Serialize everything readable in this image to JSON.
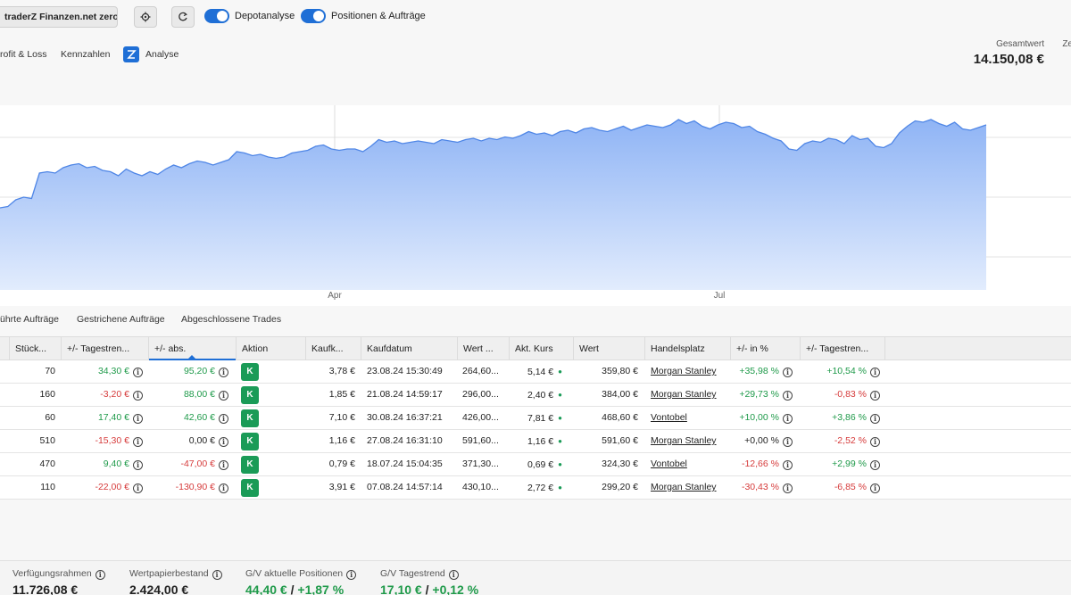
{
  "toolbar": {
    "account_label": "traderZ Finanzen.net zero",
    "toggle1_label": "Depotanalyse",
    "toggle2_label": "Positionen & Aufträge"
  },
  "subnav": {
    "items": [
      "rofit & Loss",
      "Kennzahlen",
      "Analyse"
    ]
  },
  "total": {
    "label": "Gesamtwert",
    "value": "14.150,08 €",
    "next_label": "Ze"
  },
  "chart_data": {
    "type": "area",
    "title": "",
    "xlabel": "",
    "ylabel": "",
    "x_tick_labels": [
      "Apr",
      "Jul"
    ],
    "grid": true,
    "color": "#8fb4f5",
    "line_color": "#4f86e6",
    "series": [
      {
        "values": [
          0.36,
          0.37,
          0.42,
          0.44,
          0.43,
          0.62,
          0.63,
          0.62,
          0.66,
          0.68,
          0.69,
          0.66,
          0.67,
          0.64,
          0.63,
          0.6,
          0.65,
          0.62,
          0.6,
          0.63,
          0.61,
          0.65,
          0.68,
          0.66,
          0.69,
          0.71,
          0.7,
          0.68,
          0.7,
          0.72,
          0.78,
          0.77,
          0.75,
          0.76,
          0.74,
          0.73,
          0.74,
          0.77,
          0.78,
          0.79,
          0.82,
          0.83,
          0.8,
          0.79,
          0.8,
          0.8,
          0.78,
          0.82,
          0.87,
          0.85,
          0.86,
          0.84,
          0.85,
          0.86,
          0.85,
          0.84,
          0.87,
          0.86,
          0.85,
          0.87,
          0.88,
          0.86,
          0.88,
          0.87,
          0.89,
          0.88,
          0.9,
          0.93,
          0.91,
          0.92,
          0.9,
          0.93,
          0.94,
          0.92,
          0.95,
          0.96,
          0.94,
          0.93,
          0.95,
          0.97,
          0.94,
          0.96,
          0.98,
          0.97,
          0.96,
          0.98,
          1.02,
          0.99,
          1.01,
          0.97,
          0.95,
          0.98,
          1.0,
          0.99,
          0.96,
          0.97,
          0.93,
          0.91,
          0.88,
          0.86,
          0.8,
          0.79,
          0.84,
          0.86,
          0.85,
          0.88,
          0.87,
          0.84,
          0.9,
          0.87,
          0.88,
          0.82,
          0.81,
          0.84,
          0.92,
          0.97,
          1.01,
          1.0,
          1.02,
          0.99,
          0.97,
          1.0,
          0.95,
          0.94,
          0.96,
          0.98
        ]
      }
    ]
  },
  "tabs": [
    "ührte Aufträge",
    "Gestrichene Aufträge",
    "Abgeschlossene Trades"
  ],
  "table": {
    "headers": [
      "Stück...",
      "+/- Tagestren...",
      "+/- abs.",
      "Aktion",
      "Kaufk...",
      "Kaufdatum",
      "Wert ...",
      "Akt. Kurs",
      "Wert",
      "Handelsplatz",
      "+/- in %",
      "+/- Tagestren..."
    ],
    "rows": [
      {
        "qty": "70",
        "day": "34,30 €",
        "day_sign": "pos",
        "abs": "95,20 €",
        "abs_sign": "pos",
        "action": "K",
        "buy": "3,78 €",
        "date": "23.08.24 15:30:49",
        "buyval": "264,60...",
        "price": "5,14 €",
        "value": "359,80 €",
        "venue": "Morgan Stanley",
        "pct": "+35,98 %",
        "pct_sign": "pos",
        "trend": "+10,54 %",
        "trend_sign": "pos"
      },
      {
        "qty": "160",
        "day": "-3,20 €",
        "day_sign": "neg",
        "abs": "88,00 €",
        "abs_sign": "pos",
        "action": "K",
        "buy": "1,85 €",
        "date": "21.08.24 14:59:17",
        "buyval": "296,00...",
        "price": "2,40 €",
        "value": "384,00 €",
        "venue": "Morgan Stanley",
        "pct": "+29,73 %",
        "pct_sign": "pos",
        "trend": "-0,83 %",
        "trend_sign": "neg"
      },
      {
        "qty": "60",
        "day": "17,40 €",
        "day_sign": "pos",
        "abs": "42,60 €",
        "abs_sign": "pos",
        "action": "K",
        "buy": "7,10 €",
        "date": "30.08.24 16:37:21",
        "buyval": "426,00...",
        "price": "7,81 €",
        "value": "468,60 €",
        "venue": "Vontobel",
        "pct": "+10,00 %",
        "pct_sign": "pos",
        "trend": "+3,86 %",
        "trend_sign": "pos"
      },
      {
        "qty": "510",
        "day": "-15,30 €",
        "day_sign": "neg",
        "abs": "0,00 €",
        "abs_sign": "zero",
        "action": "K",
        "buy": "1,16 €",
        "date": "27.08.24 16:31:10",
        "buyval": "591,60...",
        "price": "1,16 €",
        "value": "591,60 €",
        "venue": "Morgan Stanley",
        "pct": "+0,00 %",
        "pct_sign": "zero",
        "trend": "-2,52 %",
        "trend_sign": "neg"
      },
      {
        "qty": "470",
        "day": "9,40 €",
        "day_sign": "pos",
        "abs": "-47,00 €",
        "abs_sign": "neg",
        "action": "K",
        "buy": "0,79 €",
        "date": "18.07.24 15:04:35",
        "buyval": "371,30...",
        "price": "0,69 €",
        "value": "324,30 €",
        "venue": "Vontobel",
        "pct": "-12,66 %",
        "pct_sign": "neg",
        "trend": "+2,99 %",
        "trend_sign": "pos"
      },
      {
        "qty": "110",
        "day": "-22,00 €",
        "day_sign": "neg",
        "abs": "-130,90 €",
        "abs_sign": "neg",
        "action": "K",
        "buy": "3,91 €",
        "date": "07.08.24 14:57:14",
        "buyval": "430,10...",
        "price": "2,72 €",
        "value": "299,20 €",
        "venue": "Morgan Stanley",
        "pct": "-30,43 %",
        "pct_sign": "neg",
        "trend": "-6,85 %",
        "trend_sign": "neg"
      }
    ]
  },
  "footer": {
    "items": [
      {
        "label": "Verfügungsrahmen",
        "value": "11.726,08 €"
      },
      {
        "label": "Wertpapierbestand",
        "value": "2.424,00 €"
      },
      {
        "label": "G/V aktuelle Positionen",
        "value_a": "44,40 €",
        "value_b": "+1,87 %"
      },
      {
        "label": "G/V Tagestrend",
        "value_a": "17,10 €",
        "value_b": "+0,12 %"
      }
    ]
  },
  "colors": {
    "accent": "#1f6fd6",
    "positive": "#1f9a4a",
    "negative": "#d63b3b",
    "badge": "#1a9b57"
  }
}
